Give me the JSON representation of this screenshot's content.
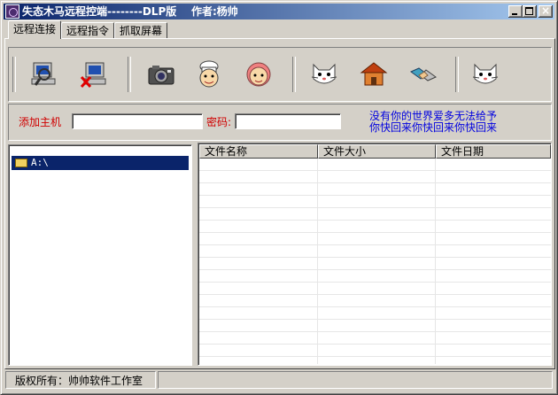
{
  "window": {
    "title": "失态木马远程控端--------DLP版    作者:杨帅",
    "controls": [
      "minimize-icon",
      "maximize-icon",
      "close-icon"
    ]
  },
  "tabs": [
    {
      "label": "远程连接",
      "active": true
    },
    {
      "label": "远程指令",
      "active": false
    },
    {
      "label": "抓取屏幕",
      "active": false
    }
  ],
  "toolbar": {
    "tools": [
      {
        "icon": "monitor-search-icon"
      },
      {
        "icon": "computer-disconnect-icon"
      },
      {
        "icon": "camera-icon"
      },
      {
        "icon": "chef-face-icon"
      },
      {
        "icon": "girl-face-icon"
      },
      {
        "icon": "cat-face-icon"
      },
      {
        "icon": "house-icon"
      },
      {
        "icon": "handshake-icon"
      },
      {
        "icon": "cat-face-icon"
      }
    ]
  },
  "connection": {
    "host_label": "添加主机",
    "host_value": "",
    "password_label": "密码:",
    "password_value": "",
    "message_line1": "没有你的世界爱多无法给予",
    "message_line2": "你快回来你快回来你快回来"
  },
  "tree": {
    "items": [
      {
        "label": "A:\\",
        "selected": true,
        "icon": "folder-open-icon"
      }
    ]
  },
  "file_list": {
    "columns": [
      "文件名称",
      "文件大小",
      "文件日期"
    ],
    "rows": []
  },
  "status": {
    "copyright": "版权所有：帅帅软件工作室",
    "panel2": ""
  },
  "colors": {
    "title_gradient_start": "#0a246a",
    "title_gradient_end": "#a6caf0",
    "label_red": "#d00000",
    "message_blue": "#0000e0",
    "selection": "#0a246a"
  }
}
